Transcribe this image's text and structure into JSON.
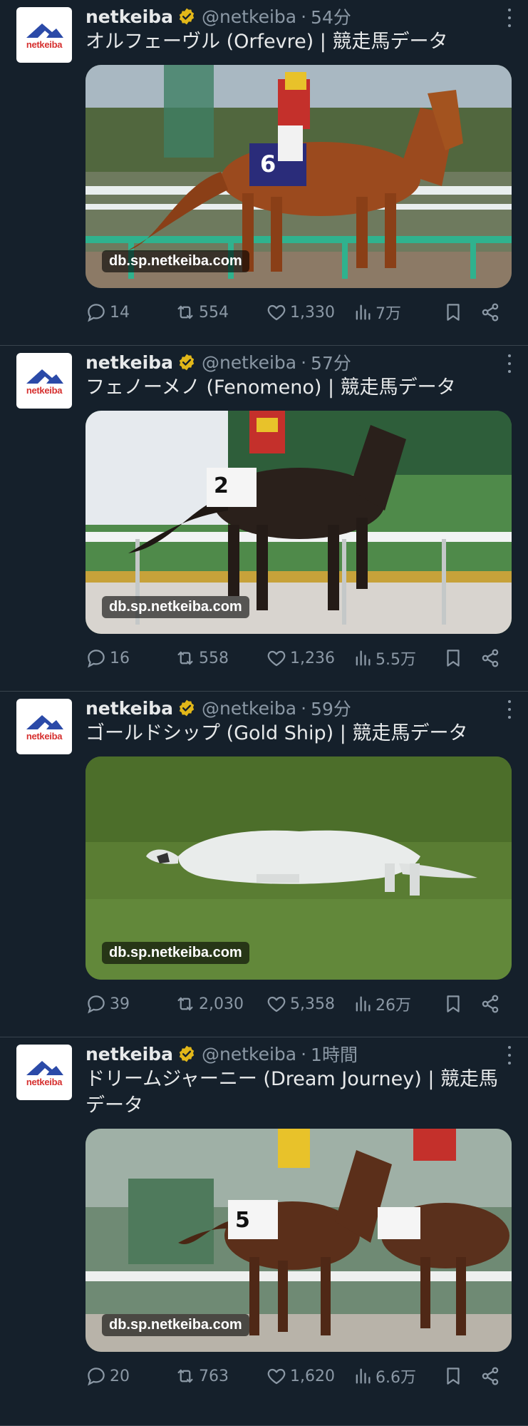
{
  "feed": {
    "tweets": [
      {
        "author": "netkeiba",
        "handle": "@netkeiba",
        "separator": "·",
        "time": "54分",
        "text": "オルフェーヴル (Orfevre) | 競走馬データ",
        "media_domain": "db.sp.netkeiba.com",
        "replies": "14",
        "retweets": "554",
        "likes": "1,330",
        "views": "7万"
      },
      {
        "author": "netkeiba",
        "handle": "@netkeiba",
        "separator": "·",
        "time": "57分",
        "text": "フェノーメノ (Fenomeno) | 競走馬データ",
        "media_domain": "db.sp.netkeiba.com",
        "replies": "16",
        "retweets": "558",
        "likes": "1,236",
        "views": "5.5万"
      },
      {
        "author": "netkeiba",
        "handle": "@netkeiba",
        "separator": "·",
        "time": "59分",
        "text": "ゴールドシップ (Gold Ship) | 競走馬データ",
        "media_domain": "db.sp.netkeiba.com",
        "replies": "39",
        "retweets": "2,030",
        "likes": "5,358",
        "views": "26万"
      },
      {
        "author": "netkeiba",
        "handle": "@netkeiba",
        "separator": "·",
        "time": "1時間",
        "text": "ドリームジャーニー (Dream Journey) | 競走馬データ",
        "media_domain": "db.sp.netkeiba.com",
        "replies": "20",
        "retweets": "763",
        "likes": "1,620",
        "views": "6.6万"
      }
    ]
  },
  "avatar_text": "netkeiba",
  "colors": {
    "background": "#15202b",
    "text": "#e7e9ea",
    "muted": "#8b98a5",
    "divider": "#38444d",
    "verified_badge": "#e2b719",
    "brand_blue": "#2b4aa8",
    "brand_red": "#d6302f"
  },
  "icons": [
    "verified-badge-icon",
    "more-icon",
    "reply-icon",
    "retweet-icon",
    "like-icon",
    "views-icon",
    "bookmark-icon",
    "share-icon"
  ]
}
